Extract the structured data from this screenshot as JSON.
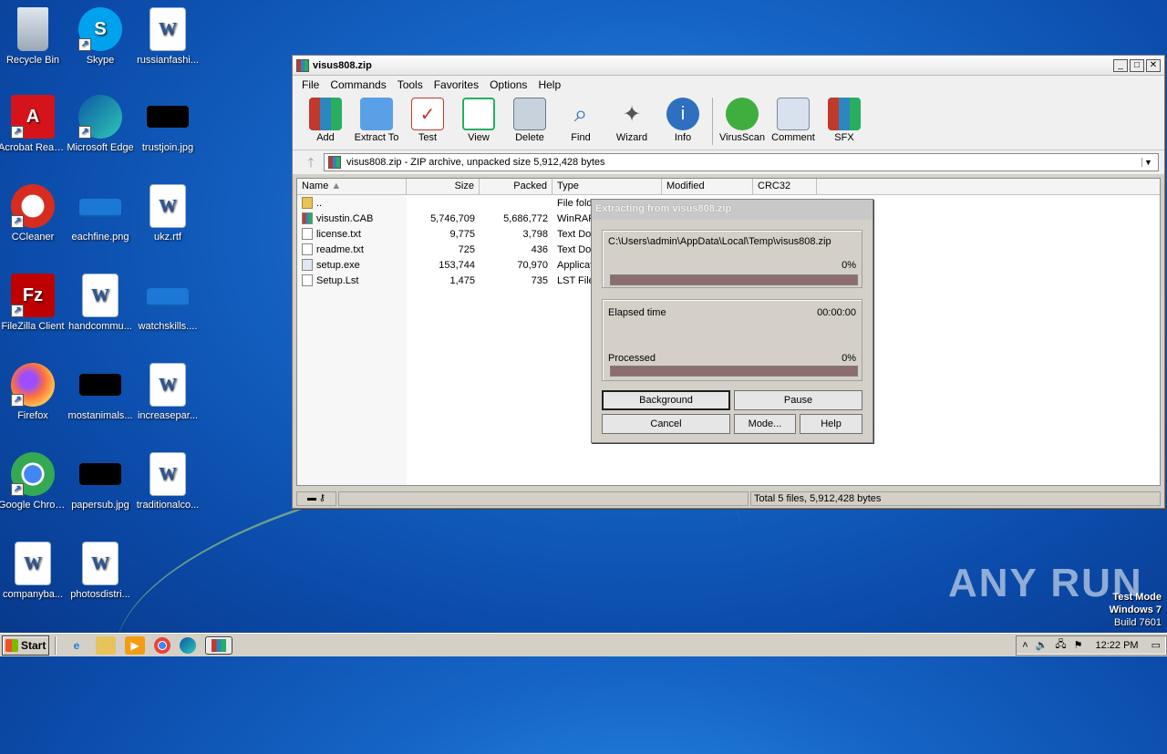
{
  "desktop": {
    "icons": [
      {
        "label": "Recycle Bin",
        "icon": "recycle-bin-icon"
      },
      {
        "label": "Skype",
        "icon": "skype-icon"
      },
      {
        "label": "russianfashi...",
        "icon": "word-document-icon"
      },
      {
        "label": "Acrobat Reader DC",
        "icon": "acrobat-reader-icon"
      },
      {
        "label": "Microsoft Edge",
        "icon": "edge-icon"
      },
      {
        "label": "trustjoin.jpg",
        "icon": "image-file-icon"
      },
      {
        "label": "CCleaner",
        "icon": "ccleaner-icon"
      },
      {
        "label": "eachfine.png",
        "icon": "image-file-icon"
      },
      {
        "label": "ukz.rtf",
        "icon": "word-document-icon"
      },
      {
        "label": "FileZilla Client",
        "icon": "filezilla-icon"
      },
      {
        "label": "handcommu...",
        "icon": "word-document-icon"
      },
      {
        "label": "watchskills....",
        "icon": "image-file-icon"
      },
      {
        "label": "Firefox",
        "icon": "firefox-icon"
      },
      {
        "label": "mostanimals...",
        "icon": "image-file-icon"
      },
      {
        "label": "increasepar...",
        "icon": "word-document-icon"
      },
      {
        "label": "Google Chrome",
        "icon": "chrome-icon"
      },
      {
        "label": "papersub.jpg",
        "icon": "image-file-icon"
      },
      {
        "label": "traditionalco...",
        "icon": "word-document-icon"
      },
      {
        "label": "companyba...",
        "icon": "word-document-icon"
      },
      {
        "label": "photosdistri...",
        "icon": "word-document-icon"
      }
    ],
    "watermark": "ANY RUN",
    "test_mode": {
      "line1": "Test Mode",
      "line2": "Windows 7",
      "line3": "Build 7601"
    }
  },
  "winrar": {
    "title": "visus808.zip",
    "menu": [
      "File",
      "Commands",
      "Tools",
      "Favorites",
      "Options",
      "Help"
    ],
    "toolbar": [
      "Add",
      "Extract To",
      "Test",
      "View",
      "Delete",
      "Find",
      "Wizard",
      "Info",
      "VirusScan",
      "Comment",
      "SFX"
    ],
    "path": "visus808.zip - ZIP archive, unpacked size 5,912,428 bytes",
    "columns": [
      "Name",
      "Size",
      "Packed",
      "Type",
      "Modified",
      "CRC32"
    ],
    "files": [
      {
        "name": "..",
        "size": "",
        "packed": "",
        "type": "File fold",
        "icon": "folder"
      },
      {
        "name": "visustin.CAB",
        "size": "5,746,709",
        "packed": "5,686,772",
        "type": "WinRAR",
        "icon": "cab"
      },
      {
        "name": "license.txt",
        "size": "9,775",
        "packed": "3,798",
        "type": "Text Do",
        "icon": "txt"
      },
      {
        "name": "readme.txt",
        "size": "725",
        "packed": "436",
        "type": "Text Do",
        "icon": "txt"
      },
      {
        "name": "setup.exe",
        "size": "153,744",
        "packed": "70,970",
        "type": "Applicat",
        "icon": "exe"
      },
      {
        "name": "Setup.Lst",
        "size": "1,475",
        "packed": "735",
        "type": "LST File",
        "icon": "txt"
      }
    ],
    "status_total": "Total 5 files, 5,912,428 bytes"
  },
  "extract_dialog": {
    "title": "Extracting from visus808.zip",
    "path": "C:\\Users\\admin\\AppData\\Local\\Temp\\visus808.zip",
    "file_percent": "0%",
    "file_progress": 0,
    "elapsed_label": "Elapsed time",
    "elapsed_value": "00:00:00",
    "processed_label": "Processed",
    "processed_percent": "0%",
    "processed_progress": 0,
    "buttons": {
      "background": "Background",
      "pause": "Pause",
      "cancel": "Cancel",
      "mode": "Mode...",
      "help": "Help"
    }
  },
  "taskbar": {
    "start": "Start",
    "clock": "12:22 PM"
  }
}
